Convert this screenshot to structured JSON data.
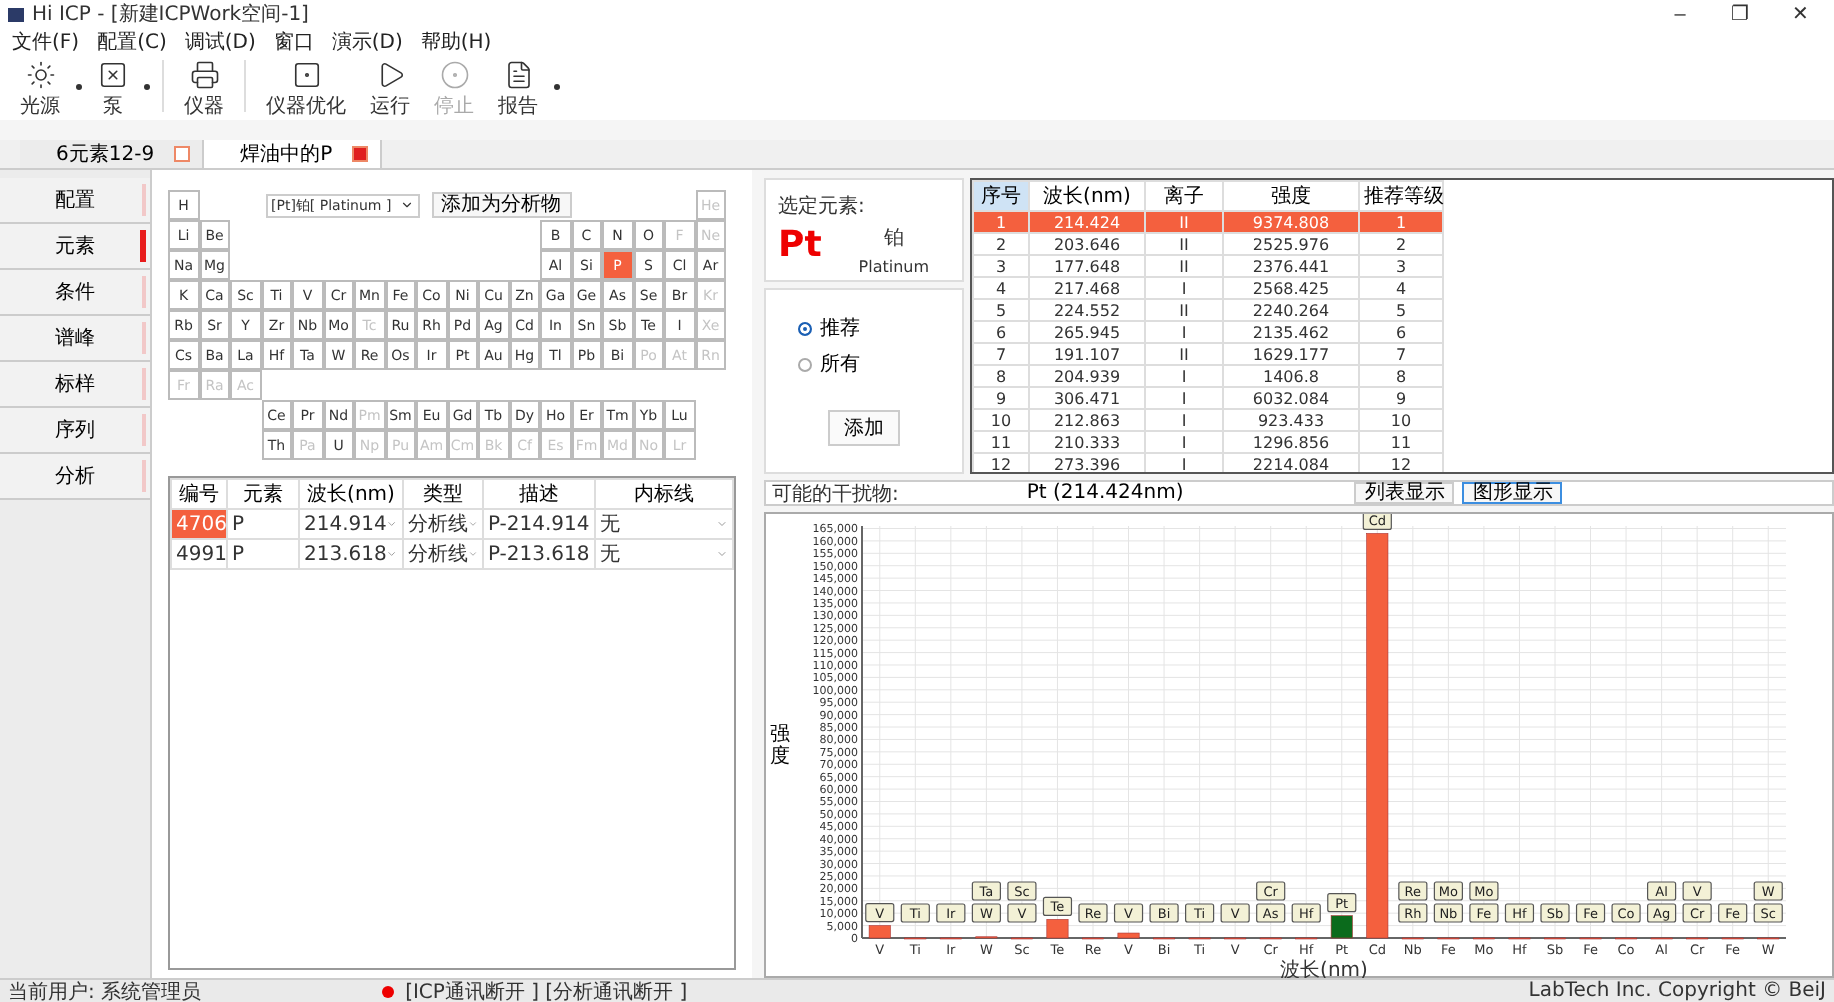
{
  "window": {
    "title": "Hi ICP - [新建ICPWork空间-1]",
    "controls": [
      "–",
      "❐",
      "✕"
    ]
  },
  "menu": [
    "文件(F)",
    "配置(C)",
    "调试(D)",
    "窗口",
    "演示(D)",
    "帮助(H)"
  ],
  "toolbar": [
    {
      "label": "光源",
      "disabled": false,
      "has_menu": true
    },
    {
      "label": "泵",
      "disabled": false,
      "has_menu": true
    },
    {
      "label": "仪器",
      "disabled": false,
      "has_menu": false
    },
    {
      "label": "仪器优化",
      "disabled": false,
      "has_menu": false
    },
    {
      "label": "运行",
      "disabled": false,
      "has_menu": false
    },
    {
      "label": "停止",
      "disabled": true,
      "has_menu": false
    },
    {
      "label": "报告",
      "disabled": false,
      "has_menu": true
    }
  ],
  "tabs": [
    {
      "label": "6元素12-9",
      "selected": false
    },
    {
      "label": "焊油中的P",
      "selected": true
    }
  ],
  "nav": [
    {
      "label": "配置",
      "selected": false
    },
    {
      "label": "元素",
      "selected": true
    },
    {
      "label": "条件",
      "selected": false
    },
    {
      "label": "谱峰",
      "selected": false
    },
    {
      "label": "标样",
      "selected": false
    },
    {
      "label": "序列",
      "selected": false
    },
    {
      "label": "分析",
      "selected": false
    }
  ],
  "element_picker": {
    "value": "[Pt]铂[ Platinum ]",
    "add_button": "添加为分析物"
  },
  "periodic_table": {
    "rows": [
      [
        {
          "symbol": "H",
          "available": true,
          "selected": false
        },
        null,
        null,
        null,
        null,
        null,
        null,
        null,
        null,
        null,
        null,
        null,
        null,
        null,
        null,
        null,
        null,
        {
          "symbol": "He",
          "available": false,
          "selected": false
        }
      ],
      [
        {
          "symbol": "Li",
          "available": true,
          "selected": false
        },
        {
          "symbol": "Be",
          "available": true,
          "selected": false
        },
        null,
        null,
        null,
        null,
        null,
        null,
        null,
        null,
        null,
        null,
        {
          "symbol": "B",
          "available": true,
          "selected": false
        },
        {
          "symbol": "C",
          "available": true,
          "selected": false
        },
        {
          "symbol": "N",
          "available": true,
          "selected": false
        },
        {
          "symbol": "O",
          "available": true,
          "selected": false
        },
        {
          "symbol": "F",
          "available": false,
          "selected": false
        },
        {
          "symbol": "Ne",
          "available": false,
          "selected": false
        }
      ],
      [
        {
          "symbol": "Na",
          "available": true,
          "selected": false
        },
        {
          "symbol": "Mg",
          "available": true,
          "selected": false
        },
        null,
        null,
        null,
        null,
        null,
        null,
        null,
        null,
        null,
        null,
        {
          "symbol": "Al",
          "available": true,
          "selected": false
        },
        {
          "symbol": "Si",
          "available": true,
          "selected": false
        },
        {
          "symbol": "P",
          "available": true,
          "selected": true
        },
        {
          "symbol": "S",
          "available": true,
          "selected": false
        },
        {
          "symbol": "Cl",
          "available": true,
          "selected": false
        },
        {
          "symbol": "Ar",
          "available": true,
          "selected": false
        }
      ],
      [
        {
          "symbol": "K",
          "available": true,
          "selected": false
        },
        {
          "symbol": "Ca",
          "available": true,
          "selected": false
        },
        {
          "symbol": "Sc",
          "available": true,
          "selected": false
        },
        {
          "symbol": "Ti",
          "available": true,
          "selected": false
        },
        {
          "symbol": "V",
          "available": true,
          "selected": false
        },
        {
          "symbol": "Cr",
          "available": true,
          "selected": false
        },
        {
          "symbol": "Mn",
          "available": true,
          "selected": false
        },
        {
          "symbol": "Fe",
          "available": true,
          "selected": false
        },
        {
          "symbol": "Co",
          "available": true,
          "selected": false
        },
        {
          "symbol": "Ni",
          "available": true,
          "selected": false
        },
        {
          "symbol": "Cu",
          "available": true,
          "selected": false
        },
        {
          "symbol": "Zn",
          "available": true,
          "selected": false
        },
        {
          "symbol": "Ga",
          "available": true,
          "selected": false
        },
        {
          "symbol": "Ge",
          "available": true,
          "selected": false
        },
        {
          "symbol": "As",
          "available": true,
          "selected": false
        },
        {
          "symbol": "Se",
          "available": true,
          "selected": false
        },
        {
          "symbol": "Br",
          "available": true,
          "selected": false
        },
        {
          "symbol": "Kr",
          "available": false,
          "selected": false
        }
      ],
      [
        {
          "symbol": "Rb",
          "available": true,
          "selected": false
        },
        {
          "symbol": "Sr",
          "available": true,
          "selected": false
        },
        {
          "symbol": "Y",
          "available": true,
          "selected": false
        },
        {
          "symbol": "Zr",
          "available": true,
          "selected": false
        },
        {
          "symbol": "Nb",
          "available": true,
          "selected": false
        },
        {
          "symbol": "Mo",
          "available": true,
          "selected": false
        },
        {
          "symbol": "Tc",
          "available": false,
          "selected": false
        },
        {
          "symbol": "Ru",
          "available": true,
          "selected": false
        },
        {
          "symbol": "Rh",
          "available": true,
          "selected": false
        },
        {
          "symbol": "Pd",
          "available": true,
          "selected": false
        },
        {
          "symbol": "Ag",
          "available": true,
          "selected": false
        },
        {
          "symbol": "Cd",
          "available": true,
          "selected": false
        },
        {
          "symbol": "In",
          "available": true,
          "selected": false
        },
        {
          "symbol": "Sn",
          "available": true,
          "selected": false
        },
        {
          "symbol": "Sb",
          "available": true,
          "selected": false
        },
        {
          "symbol": "Te",
          "available": true,
          "selected": false
        },
        {
          "symbol": "I",
          "available": true,
          "selected": false
        },
        {
          "symbol": "Xe",
          "available": false,
          "selected": false
        }
      ],
      [
        {
          "symbol": "Cs",
          "available": true,
          "selected": false
        },
        {
          "symbol": "Ba",
          "available": true,
          "selected": false
        },
        {
          "symbol": "La",
          "available": true,
          "selected": false
        },
        {
          "symbol": "Hf",
          "available": true,
          "selected": false
        },
        {
          "symbol": "Ta",
          "available": true,
          "selected": false
        },
        {
          "symbol": "W",
          "available": true,
          "selected": false
        },
        {
          "symbol": "Re",
          "available": true,
          "selected": false
        },
        {
          "symbol": "Os",
          "available": true,
          "selected": false
        },
        {
          "symbol": "Ir",
          "available": true,
          "selected": false
        },
        {
          "symbol": "Pt",
          "available": true,
          "selected": false
        },
        {
          "symbol": "Au",
          "available": true,
          "selected": false
        },
        {
          "symbol": "Hg",
          "available": true,
          "selected": false
        },
        {
          "symbol": "Tl",
          "available": true,
          "selected": false
        },
        {
          "symbol": "Pb",
          "available": true,
          "selected": false
        },
        {
          "symbol": "Bi",
          "available": true,
          "selected": false
        },
        {
          "symbol": "Po",
          "available": false,
          "selected": false
        },
        {
          "symbol": "At",
          "available": false,
          "selected": false
        },
        {
          "symbol": "Rn",
          "available": false,
          "selected": false
        }
      ],
      [
        {
          "symbol": "Fr",
          "available": false,
          "selected": false
        },
        {
          "symbol": "Ra",
          "available": false,
          "selected": false
        },
        {
          "symbol": "Ac",
          "available": false,
          "selected": false
        }
      ],
      [
        null,
        null,
        null,
        {
          "symbol": "Ce",
          "available": true,
          "selected": false
        },
        {
          "symbol": "Pr",
          "available": true,
          "selected": false
        },
        {
          "symbol": "Nd",
          "available": true,
          "selected": false
        },
        {
          "symbol": "Pm",
          "available": false,
          "selected": false
        },
        {
          "symbol": "Sm",
          "available": true,
          "selected": false
        },
        {
          "symbol": "Eu",
          "available": true,
          "selected": false
        },
        {
          "symbol": "Gd",
          "available": true,
          "selected": false
        },
        {
          "symbol": "Tb",
          "available": true,
          "selected": false
        },
        {
          "symbol": "Dy",
          "available": true,
          "selected": false
        },
        {
          "symbol": "Ho",
          "available": true,
          "selected": false
        },
        {
          "symbol": "Er",
          "available": true,
          "selected": false
        },
        {
          "symbol": "Tm",
          "available": true,
          "selected": false
        },
        {
          "symbol": "Yb",
          "available": true,
          "selected": false
        },
        {
          "symbol": "Lu",
          "available": true,
          "selected": false
        }
      ],
      [
        null,
        null,
        null,
        {
          "symbol": "Th",
          "available": true,
          "selected": false
        },
        {
          "symbol": "Pa",
          "available": false,
          "selected": false
        },
        {
          "symbol": "U",
          "available": true,
          "selected": false
        },
        {
          "symbol": "Np",
          "available": false,
          "selected": false
        },
        {
          "symbol": "Pu",
          "available": false,
          "selected": false
        },
        {
          "symbol": "Am",
          "available": false,
          "selected": false
        },
        {
          "symbol": "Cm",
          "available": false,
          "selected": false
        },
        {
          "symbol": "Bk",
          "available": false,
          "selected": false
        },
        {
          "symbol": "Cf",
          "available": false,
          "selected": false
        },
        {
          "symbol": "Es",
          "available": false,
          "selected": false
        },
        {
          "symbol": "Fm",
          "available": false,
          "selected": false
        },
        {
          "symbol": "Md",
          "available": false,
          "selected": false
        },
        {
          "symbol": "No",
          "available": false,
          "selected": false
        },
        {
          "symbol": "Lr",
          "available": false,
          "selected": false
        }
      ]
    ]
  },
  "analyte_table": {
    "columns": [
      "编号",
      "元素",
      "波长(nm)",
      "类型",
      "描述",
      "内标线"
    ],
    "rows": [
      {
        "selected": true,
        "cells": [
          "4706",
          "P",
          "214.914",
          "分析线",
          "P-214.914",
          "无"
        ]
      },
      {
        "selected": false,
        "cells": [
          "4991",
          "P",
          "213.618",
          "分析线",
          "P-213.618",
          "无"
        ]
      }
    ]
  },
  "element_card": {
    "label": "选定元素:",
    "symbol": "Pt",
    "name_cn": "铂",
    "name_en": "Platinum"
  },
  "line_filter": [
    {
      "label": "推荐",
      "selected": true
    },
    {
      "label": "所有",
      "selected": false
    }
  ],
  "add_button": "添加",
  "lines_table": {
    "columns": [
      "序号",
      "波长(nm)",
      "离子",
      "强度",
      "推荐等级"
    ],
    "rows": [
      {
        "selected": true,
        "cells": [
          "1",
          "214.424",
          "II",
          "9374.808",
          "1"
        ]
      },
      {
        "selected": false,
        "cells": [
          "2",
          "203.646",
          "II",
          "2525.976",
          "2"
        ]
      },
      {
        "selected": false,
        "cells": [
          "3",
          "177.648",
          "II",
          "2376.441",
          "3"
        ]
      },
      {
        "selected": false,
        "cells": [
          "4",
          "217.468",
          "I",
          "2568.425",
          "4"
        ]
      },
      {
        "selected": false,
        "cells": [
          "5",
          "224.552",
          "II",
          "2240.264",
          "5"
        ]
      },
      {
        "selected": false,
        "cells": [
          "6",
          "265.945",
          "I",
          "2135.462",
          "6"
        ]
      },
      {
        "selected": false,
        "cells": [
          "7",
          "191.107",
          "II",
          "1629.177",
          "7"
        ]
      },
      {
        "selected": false,
        "cells": [
          "8",
          "204.939",
          "I",
          "1406.8",
          "8"
        ]
      },
      {
        "selected": false,
        "cells": [
          "9",
          "306.471",
          "I",
          "6032.084",
          "9"
        ]
      },
      {
        "selected": false,
        "cells": [
          "10",
          "212.863",
          "I",
          "923.433",
          "10"
        ]
      },
      {
        "selected": false,
        "cells": [
          "11",
          "210.333",
          "I",
          "1296.856",
          "11"
        ]
      },
      {
        "selected": false,
        "cells": [
          "12",
          "273.396",
          "I",
          "2214.084",
          "12"
        ]
      }
    ]
  },
  "interference": {
    "label": "可能的干扰物:",
    "value": "Pt (214.424nm)",
    "views": [
      {
        "label": "列表显示",
        "selected": false
      },
      {
        "label": "图形显示",
        "selected": true
      }
    ]
  },
  "chart": {
    "chart_data": {
      "type": "bar",
      "xlabel": "波长(nm)",
      "ylabel": "强度",
      "categories": [
        "V",
        "Ti",
        "Ir",
        "W",
        "Sc",
        "Te",
        "Re",
        "V",
        "Bi",
        "Ti",
        "V",
        "Cr",
        "Hf",
        "Pt",
        "Cd",
        "Nb",
        "Fe",
        "Mo",
        "Hf",
        "Sb",
        "Fe",
        "Co",
        "Al",
        "Cr",
        "Fe",
        "W"
      ],
      "ylim": [
        0,
        166000
      ],
      "yticks": [
        {
          "value": 0,
          "label": "0"
        },
        {
          "value": 5000,
          "label": "5,000"
        },
        {
          "value": 10000,
          "label": "10,000"
        },
        {
          "value": 15000,
          "label": "15,000"
        },
        {
          "value": 20000,
          "label": "20,000"
        },
        {
          "value": 25000,
          "label": "25,000"
        },
        {
          "value": 30000,
          "label": "30,000"
        },
        {
          "value": 35000,
          "label": "35,000"
        },
        {
          "value": 40000,
          "label": "40,000"
        },
        {
          "value": 45000,
          "label": "45,000"
        },
        {
          "value": 50000,
          "label": "50,000"
        },
        {
          "value": 55000,
          "label": "55,000"
        },
        {
          "value": 60000,
          "label": "60,000"
        },
        {
          "value": 65000,
          "label": "65,000"
        },
        {
          "value": 70000,
          "label": "70,000"
        },
        {
          "value": 75000,
          "label": "75,000"
        },
        {
          "value": 80000,
          "label": "80,000"
        },
        {
          "value": 85000,
          "label": "85,000"
        },
        {
          "value": 90000,
          "label": "90,000"
        },
        {
          "value": 95000,
          "label": "95,000"
        },
        {
          "value": 100000,
          "label": "100,000"
        },
        {
          "value": 105000,
          "label": "105,000"
        },
        {
          "value": 110000,
          "label": "110,000"
        },
        {
          "value": 115000,
          "label": "115,000"
        },
        {
          "value": 120000,
          "label": "120,000"
        },
        {
          "value": 125000,
          "label": "125,000"
        },
        {
          "value": 130000,
          "label": "130,000"
        },
        {
          "value": 135000,
          "label": "135,000"
        },
        {
          "value": 140000,
          "label": "140,000"
        },
        {
          "value": 145000,
          "label": "145,000"
        },
        {
          "value": 150000,
          "label": "150,000"
        },
        {
          "value": 155000,
          "label": "155,000"
        },
        {
          "value": 160000,
          "label": "160,000"
        },
        {
          "value": 165000,
          "label": "165,000"
        }
      ],
      "series": [
        {
          "color": "#f4603e",
          "values": [
            5000,
            0,
            0,
            500,
            0,
            7500,
            0,
            2000,
            0,
            0,
            0,
            0,
            0,
            null,
            163000,
            0,
            0,
            0,
            0,
            0,
            0,
            0,
            0,
            0,
            0,
            0
          ]
        },
        {
          "color": "#0b6b1c",
          "values": [
            null,
            null,
            null,
            null,
            null,
            null,
            null,
            null,
            null,
            null,
            null,
            null,
            null,
            9000,
            null,
            null,
            null,
            null,
            null,
            null,
            null,
            null,
            null,
            null,
            null,
            null
          ]
        }
      ],
      "grid": true
    },
    "peak_tags": [
      [
        "V"
      ],
      [
        "Ti"
      ],
      [
        "Ir"
      ],
      [
        "Ta",
        "W"
      ],
      [
        "Sc",
        "V"
      ],
      [
        "Te"
      ],
      [
        "Re"
      ],
      [
        "V"
      ],
      [
        "Bi"
      ],
      [
        "Ti"
      ],
      [
        "V"
      ],
      [
        "Cr",
        "As"
      ],
      [
        "Hf"
      ],
      [
        "Pt"
      ],
      [
        "Cd"
      ],
      [
        "Re",
        "Rh"
      ],
      [
        "Mo",
        "Nb"
      ],
      [
        "Mo",
        "Fe"
      ],
      [
        "Hf"
      ],
      [
        "Sb"
      ],
      [
        "Fe"
      ],
      [
        "Co"
      ],
      [
        "Al",
        "Ag"
      ],
      [
        "V",
        "Cr"
      ],
      [
        "Fe"
      ],
      [
        "W",
        "Sc"
      ]
    ]
  },
  "status_bar": {
    "user": "当前用户: 系统管理员",
    "connection_ok": false,
    "connection": "[ICP通讯断开 ]  [分析通讯断开 ]",
    "copyright": "LabTech Inc.  Copyright © BeiJ"
  }
}
